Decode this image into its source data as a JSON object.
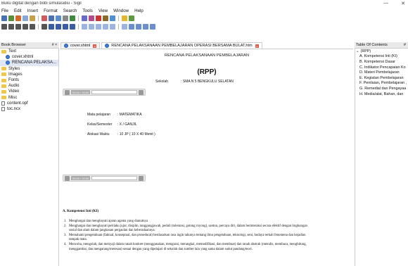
{
  "window": {
    "title": "Buku digital dengan bobi simulasidiu - Sigil",
    "controls": [
      "—",
      "✕"
    ]
  },
  "menu": [
    "File",
    "Edit",
    "Insert",
    "Format",
    "Search",
    "Tools",
    "View",
    "Window",
    "Help"
  ],
  "toolbar1_colors": [
    "#4a6fb5",
    "#5a8f3a",
    "#d16a2c",
    "#8aa8d6",
    "#c6a04a",
    "#d35b5b",
    "#4a6fb5",
    "#5b8bd0",
    "#888888",
    "#3e8a3e",
    "#6a6ac8",
    "#b44b8b",
    "#cc3333",
    "#8a6a2a",
    "#4f8fcf",
    "#e0b82a",
    "#5f9a3f"
  ],
  "toolbar2_colors": [
    "#555555",
    "#555555",
    "#555555",
    "#555555",
    "#555555",
    "#555555",
    "#3b5ca8",
    "#3b5ca8",
    "#3b5ca8",
    "#3b5ca8",
    "#9bb4e0",
    "#9bb4e0",
    "#9bb4e0",
    "#9bb4e0",
    "#9bb4e0",
    "#9bb4e0",
    "#6a8fd1",
    "#6a8fd1",
    "#6a8fd1",
    "#6a8fd1"
  ],
  "book_browser": {
    "title": "Book Browser",
    "pin": "# ×",
    "items": [
      {
        "label": "Text",
        "kind": "folder",
        "level": 0
      },
      {
        "label": "cover.xhtml",
        "kind": "html",
        "level": 1
      },
      {
        "label": "RENCANA PELAKSA...",
        "kind": "html",
        "level": 1,
        "selected": true
      },
      {
        "label": "Styles",
        "kind": "folder",
        "level": 0
      },
      {
        "label": "Images",
        "kind": "folder",
        "level": 0
      },
      {
        "label": "Fonts",
        "kind": "folder",
        "level": 0
      },
      {
        "label": "Audio",
        "kind": "folder",
        "level": 0
      },
      {
        "label": "Video",
        "kind": "folder",
        "level": 0
      },
      {
        "label": "Misc",
        "kind": "folder",
        "level": 0
      },
      {
        "label": "content.opf",
        "kind": "file",
        "level": 0
      },
      {
        "label": "toc.ncx",
        "kind": "file",
        "level": 0
      }
    ]
  },
  "tabs": [
    {
      "label": "cover.xhtml",
      "active": false
    },
    {
      "label": "RENCANA PELAKSANAAN PEMBELAJARAN OPERASI BERSAMA BULAT.htm",
      "active": true
    }
  ],
  "document": {
    "header": "RENCANA PELAKSANAAN PEMBELAJARAN",
    "rpp": "(RPP)",
    "school_label": "Sekolah",
    "school_value": ": SMA N 5 BENGKULU SELATAN",
    "media_time": "00:00 / 00:00",
    "info": [
      {
        "k": "Mata pelajaran",
        "v": ": MATEMATIKA"
      },
      {
        "k": "Kelas/Semester",
        "v": ": X / GANJIL"
      },
      {
        "k": "Alokasi Waktu",
        "v": ": 10 JP ( 10 X 40 Menit )"
      }
    ],
    "section_title": "A.  Kompetensi Inti (KI)",
    "ki": [
      {
        "n": "1.",
        "t": "Menghargai dan menghayati ajaran agama yang dianutnya"
      },
      {
        "n": "2.",
        "t": "Menghargai dan menghayati perilaku jujur, disiplin, tanggungjawab, peduli (toleransi, gotong royong), santun, percaya diri, dalam berinteraksi secara efektif dengan lingkungan"
      },
      {
        "n": "",
        "t": "sosial dan alam dalam jangkauan pergaulan dan keberadaannya."
      },
      {
        "n": "3.",
        "t": "Memahami pengetahuan (faktual, konseptual, dan prosedural) berdasarkan rasa ingin tahunya tentang ilmu pengetahuan, teknologi, seni, budaya terkait fenomena dan kejadian"
      },
      {
        "n": "",
        "t": "tampak mata."
      },
      {
        "n": "4.",
        "t": "Mencoba, mengolah, dan menyaji dalam ranah konkret (menggunakan, mengurai, merangkai, memodifikasi, dan membuat) dan ranah abstrak (menulis, membaca, menghitung,"
      },
      {
        "n": "",
        "t": "menggambar, dan mengarang/meresan) sesuai dengan yang dipelajari di sekolah dan sumber lain yang sama dalam sudut pandang/teori."
      }
    ]
  },
  "toc": {
    "title": "Table Of Contents",
    "pin": "#",
    "items": [
      {
        "label": "(RPP)",
        "root": true
      },
      {
        "label": "A. Kompetensi Inti (KI)"
      },
      {
        "label": "B. Kompetensi Dasar"
      },
      {
        "label": "C. Indikator Pencapaian Ko"
      },
      {
        "label": "D. Materi Pembelajaran"
      },
      {
        "label": "E. Kegiatan Pembelajaran"
      },
      {
        "label": "F. Penilaian, Pembelajaran ,"
      },
      {
        "label": "G. Remedial dan Pengayaa"
      },
      {
        "label": "H. Media/alat, Bahan, dan"
      }
    ]
  }
}
